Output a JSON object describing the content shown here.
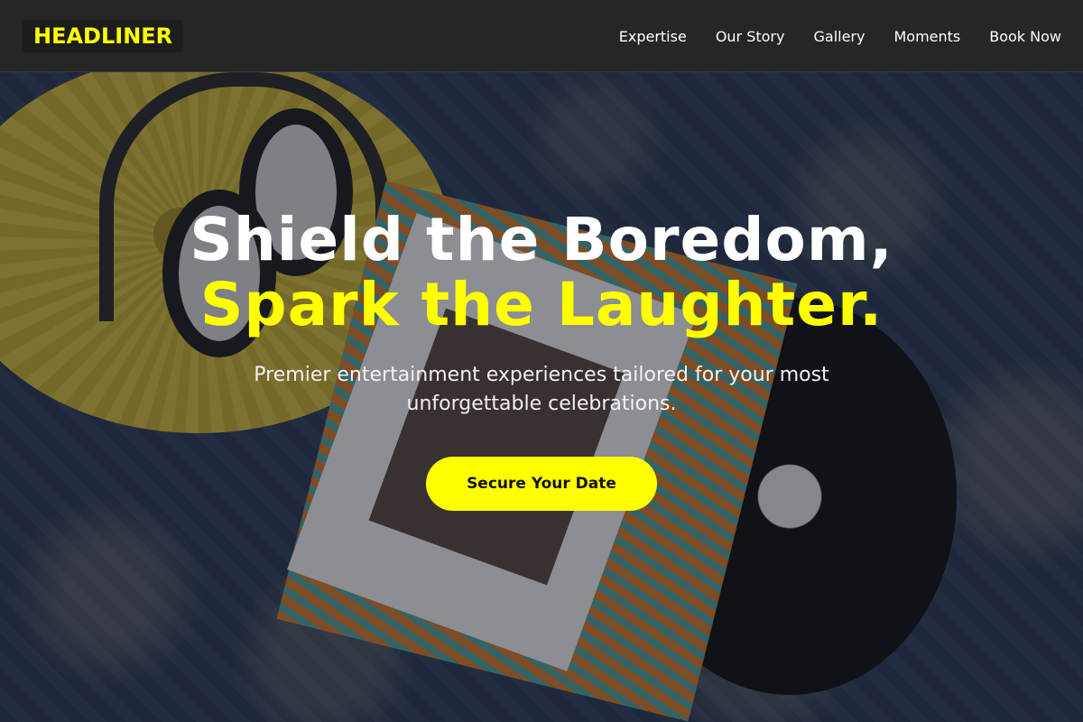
{
  "header": {
    "brand": "HEADLINER",
    "nav": [
      {
        "label": "Expertise"
      },
      {
        "label": "Our Story"
      },
      {
        "label": "Gallery"
      },
      {
        "label": "Moments"
      },
      {
        "label": "Book Now"
      }
    ]
  },
  "hero": {
    "headline_line1": "Shield the Boredom,",
    "headline_line2": "Spark the Laughter.",
    "subtitle": "Premier entertainment experiences tailored for your most unforgettable celebrations.",
    "cta_label": "Secure Your Date"
  },
  "colors": {
    "accent": "#ffff00",
    "header_bg": "#262626",
    "text": "#ffffff"
  }
}
